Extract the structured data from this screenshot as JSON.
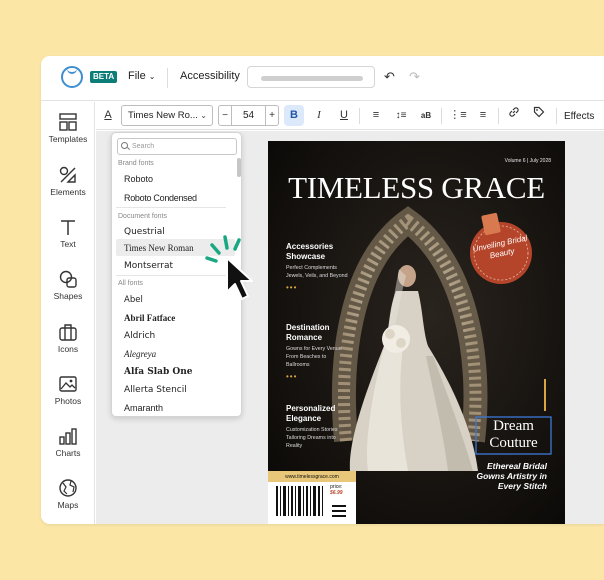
{
  "topbar": {
    "badge": "BETA",
    "file_menu": "File",
    "accessibility_menu": "Accessibility"
  },
  "sidebar": {
    "items": [
      {
        "label": "Templates",
        "icon": "templates-icon"
      },
      {
        "label": "Elements",
        "icon": "elements-icon"
      },
      {
        "label": "Text",
        "icon": "text-icon"
      },
      {
        "label": "Shapes",
        "icon": "shapes-icon"
      },
      {
        "label": "Icons",
        "icon": "icons-icon"
      },
      {
        "label": "Photos",
        "icon": "photos-icon"
      },
      {
        "label": "Charts",
        "icon": "charts-icon"
      },
      {
        "label": "Maps",
        "icon": "maps-icon"
      }
    ]
  },
  "toolbar": {
    "font_value": "Times New Ro...",
    "size_minus": "−",
    "size_plus": "+",
    "font_size": "54",
    "bold_label": "B",
    "italic_label": "I",
    "underline_label": "U",
    "effects_label": "Effects"
  },
  "font_dropdown": {
    "search_placeholder": "Search",
    "brand_heading": "Brand fonts",
    "brand_fonts": [
      "Roboto",
      "Roboto Condensed"
    ],
    "document_heading": "Document fonts",
    "document_fonts": [
      "Questrial",
      "Times New Roman",
      "Montserrat"
    ],
    "all_heading": "All fonts",
    "all_fonts": [
      "Abel",
      "Abril Fatface",
      "Aldrich",
      "Alegreya",
      "Alfa Slab One",
      "Allerta Stencil",
      "Amaranth"
    ]
  },
  "magazine": {
    "issue": "Volume 6 | July 2028",
    "title": "TIMELESS GRACE",
    "badge": "Unveiling Bridal Beauty",
    "sections": [
      {
        "heading": "Accessories Showcase",
        "body": "Perfect Complements Jewels, Veils, and Beyond"
      },
      {
        "heading": "Destination Romance",
        "body": "Gowns for Every Venue From Beaches to Ballrooms"
      },
      {
        "heading": "Personalized Elegance",
        "body": "Customization Stories Tailoring Dreams into Reality"
      }
    ],
    "dots": "•••",
    "feature_title": "Dream Couture",
    "feature_body": "Ethereal Bridal Gowns Artistry in Every Stitch",
    "website": "www.timelessgrace.com",
    "price_label": "price:",
    "price": "$6.99"
  },
  "colors": {
    "background": "#fbe6a6",
    "brand_teal": "#0d7d78",
    "accent_gold": "#d9a441",
    "badge_red": "#b5452a",
    "annotation_green": "#1aa883"
  }
}
